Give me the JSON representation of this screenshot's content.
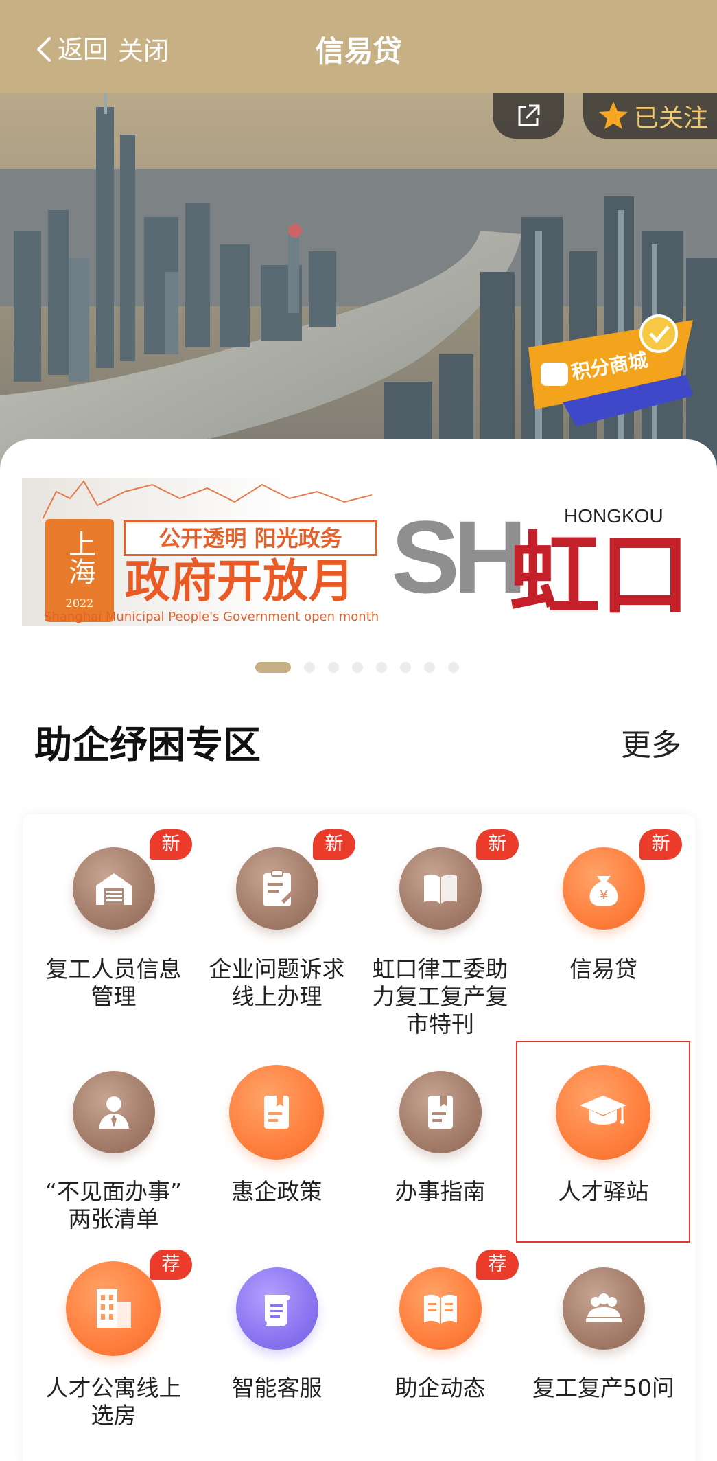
{
  "navbar": {
    "back_label": "返回",
    "close_label": "关闭",
    "title": "信易贷"
  },
  "hero": {
    "follow_label": "已关注",
    "points_mall_label": "积分商城"
  },
  "banner": {
    "seal_chars": "上海",
    "seal_year": "2022",
    "slogan": "公开透明  阳光政务",
    "headline": "政府开放月",
    "subtitle": "Shanghai Municipal People's Government open month",
    "sh_text": "SH",
    "district_en": "HONGKOU",
    "district_cn": "虹口"
  },
  "carousel": {
    "total": 8,
    "active_index": 0
  },
  "section": {
    "title": "助企纾困专区",
    "more_label": "更多"
  },
  "tiles": [
    {
      "label_line1": "复工人员信息",
      "label_line2": "管理",
      "label_line3": "",
      "badge": "新",
      "icon": "warehouse-icon",
      "color": "brown"
    },
    {
      "label_line1": "企业问题诉求",
      "label_line2": "线上办理",
      "label_line3": "",
      "badge": "新",
      "icon": "clipboard-edit-icon",
      "color": "brown"
    },
    {
      "label_line1": "虹口律工委助",
      "label_line2": "力复工复产复",
      "label_line3": "市特刊",
      "badge": "新",
      "icon": "open-book-icon",
      "color": "brown"
    },
    {
      "label_line1": "信易贷",
      "label_line2": "",
      "label_line3": "",
      "badge": "新",
      "icon": "money-bag-icon",
      "color": "orange"
    },
    {
      "label_line1": "“不见面办事”",
      "label_line2": "两张清单",
      "label_line3": "",
      "badge": "",
      "icon": "person-tie-icon",
      "color": "brown"
    },
    {
      "label_line1": "惠企政策",
      "label_line2": "",
      "label_line3": "",
      "badge": "",
      "icon": "policy-doc-icon",
      "color": "orange"
    },
    {
      "label_line1": "办事指南",
      "label_line2": "",
      "label_line3": "",
      "badge": "",
      "icon": "guide-doc-icon",
      "color": "brown"
    },
    {
      "label_line1": "人才驿站",
      "label_line2": "",
      "label_line3": "",
      "badge": "",
      "icon": "graduation-cap-icon",
      "color": "orange"
    },
    {
      "label_line1": "人才公寓线上",
      "label_line2": "选房",
      "label_line3": "",
      "badge": "荐",
      "icon": "apartment-building-icon",
      "color": "orange"
    },
    {
      "label_line1": "智能客服",
      "label_line2": "",
      "label_line3": "",
      "badge": "",
      "icon": "scroll-icon",
      "color": "purple"
    },
    {
      "label_line1": "助企动态",
      "label_line2": "",
      "label_line3": "",
      "badge": "荐",
      "icon": "news-book-icon",
      "color": "orange"
    },
    {
      "label_line1": "复工复产50问",
      "label_line2": "",
      "label_line3": "",
      "badge": "",
      "icon": "meeting-people-icon",
      "color": "brown"
    }
  ],
  "colors": {
    "navbar": "#c8b085",
    "badge": "#eb3b2b",
    "highlight": "#e8382c",
    "brown_icon": "#a67f6d",
    "orange_icon": "#ff7f3d",
    "purple_icon": "#8a74f0"
  }
}
